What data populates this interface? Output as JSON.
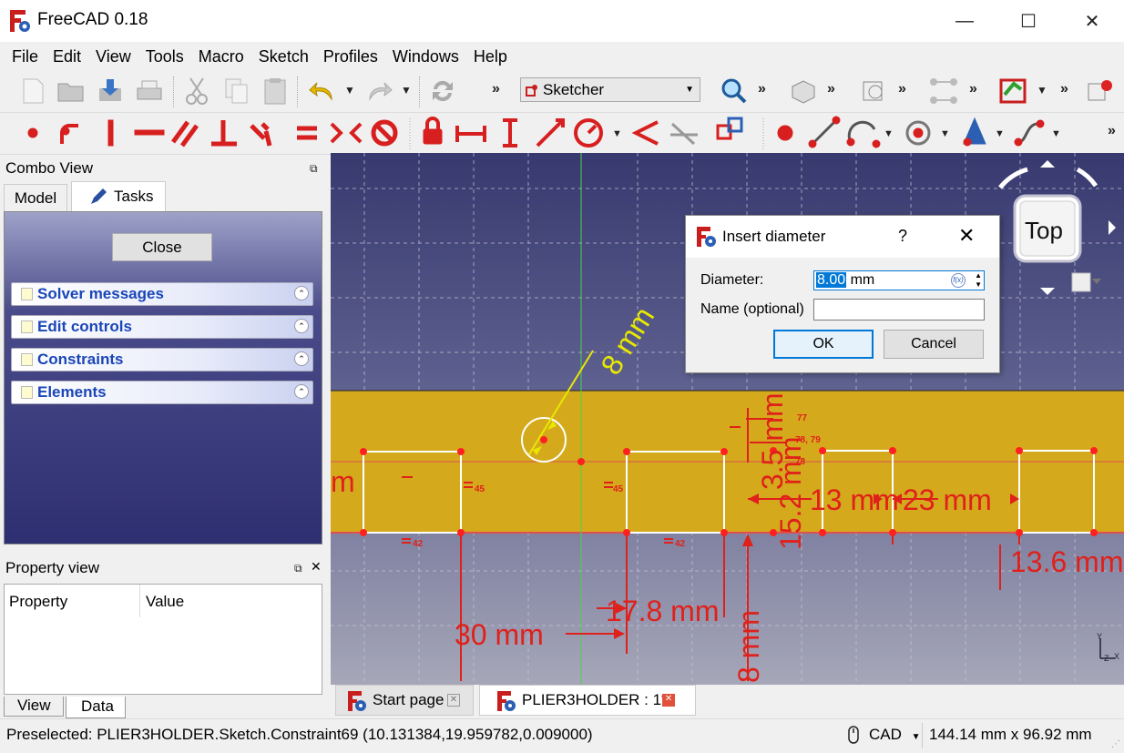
{
  "window": {
    "title": "FreeCAD 0.18",
    "minimize": "—",
    "maximize": "☐",
    "close": "✕"
  },
  "menu": [
    "File",
    "Edit",
    "View",
    "Tools",
    "Macro",
    "Sketch",
    "Profiles",
    "Windows",
    "Help"
  ],
  "toolbar": {
    "workbench": "Sketcher",
    "more": "»"
  },
  "combo_view": {
    "title": "Combo View",
    "tabs": {
      "model": "Model",
      "tasks": "Tasks"
    },
    "close_button": "Close",
    "sections": [
      "Solver messages",
      "Edit controls",
      "Constraints",
      "Elements"
    ]
  },
  "property_view": {
    "title": "Property view",
    "col_property": "Property",
    "col_value": "Value",
    "tabs": {
      "view": "View",
      "data": "Data"
    }
  },
  "dialog": {
    "title": "Insert diameter",
    "help": "?",
    "close": "✕",
    "diameter_label": "Diameter:",
    "diameter_value": "8.00",
    "diameter_unit": "mm",
    "name_label": "Name (optional)",
    "name_value": "",
    "ok": "OK",
    "cancel": "Cancel"
  },
  "nav_cube": {
    "face": "Top"
  },
  "sketch": {
    "dimensions": [
      "8 mm",
      "3.5 mm",
      "15.2 mm",
      "13 mm",
      "23 mm",
      "30 mm",
      "17.8 mm",
      "8 mm",
      "13.6 mm",
      "m"
    ],
    "constraint_labels": [
      "45",
      "45",
      "42",
      "42",
      "77",
      "78, 79",
      "78"
    ]
  },
  "doc_tabs": {
    "start": "Start page",
    "document": "PLIER3HOLDER : 1*"
  },
  "status": {
    "preselected": "Preselected: PLIER3HOLDER.Sketch.Constraint69 (10.131384,19.959782,0.009000)",
    "nav_style": "CAD",
    "dimensions": "144.14 mm x 96.92 mm"
  },
  "colors": {
    "constraint_red": "#e0201a",
    "sketch_face": "#d4aa1c",
    "selection_blue": "#0078d7"
  }
}
